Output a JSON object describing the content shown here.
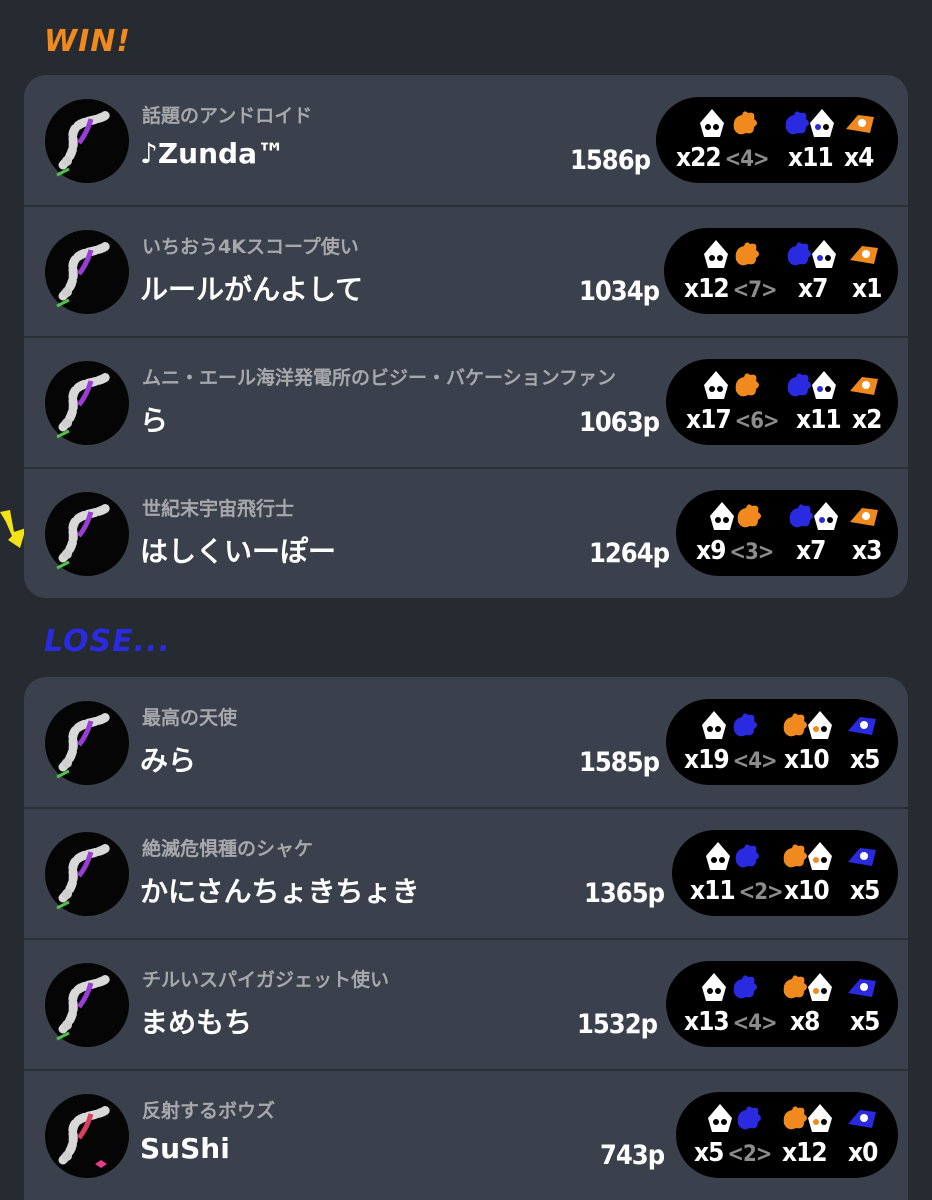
{
  "colors": {
    "team_win": "#f08a1e",
    "team_lose": "#2a2ae0",
    "panel": "#3b414c",
    "background": "#262a31"
  },
  "win": {
    "title": "WIN!",
    "players": [
      {
        "title": "話題のアンドロイド",
        "name": "♪Zunda™",
        "points": "1586p",
        "kills": "x22",
        "assists": "<4>",
        "deaths": "x11",
        "specials": "x4"
      },
      {
        "title": "いちおう4Kスコープ使い",
        "name": "ルールがんよして",
        "points": "1034p",
        "kills": "x12",
        "assists": "<7>",
        "deaths": "x7",
        "specials": "x1"
      },
      {
        "title": "ムニ・エール海洋発電所のビジー・バケーションファン",
        "name": "ら",
        "points": "1063p",
        "kills": "x17",
        "assists": "<6>",
        "deaths": "x11",
        "specials": "x2"
      },
      {
        "title": "世紀末宇宙飛行士",
        "name": "はしくいーぽー",
        "points": "1264p",
        "kills": "x9",
        "assists": "<3>",
        "deaths": "x7",
        "specials": "x3"
      }
    ]
  },
  "lose": {
    "title": "LOSE...",
    "players": [
      {
        "title": "最高の天使",
        "name": "みら",
        "points": "1585p",
        "kills": "x19",
        "assists": "<4>",
        "deaths": "x10",
        "specials": "x5"
      },
      {
        "title": "絶滅危惧種のシャケ",
        "name": "かにさんちょきちょき",
        "points": "1365p",
        "kills": "x11",
        "assists": "<2>",
        "deaths": "x10",
        "specials": "x5"
      },
      {
        "title": "チルいスパイガジェット使い",
        "name": "まめもち",
        "points": "1532p",
        "kills": "x13",
        "assists": "<4>",
        "deaths": "x8",
        "specials": "x5"
      },
      {
        "title": "反射するボウズ",
        "name": "SuShi",
        "points": "743p",
        "kills": "x5",
        "assists": "<2>",
        "deaths": "x12",
        "specials": "x0"
      }
    ]
  },
  "icons": [
    "squid-icon",
    "splat-icon",
    "special-weapon-icon",
    "self-indicator-arrow-icon"
  ]
}
